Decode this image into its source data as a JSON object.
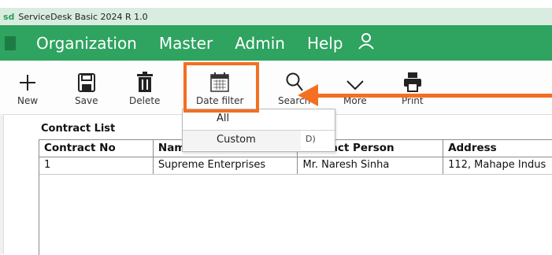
{
  "title": {
    "logo": "sd",
    "text": "ServiceDesk Basic 2024 R 1.0"
  },
  "menu": {
    "items": [
      "Organization",
      "Master",
      "Admin",
      "Help"
    ],
    "user_icon": "user-icon"
  },
  "toolbar": {
    "new_label": "New",
    "save_label": "Save",
    "delete_label": "Delete",
    "date_filter_label": "Date filter",
    "search_label": "Search",
    "more_label": "More",
    "print_label": "Print",
    "icons": [
      "plus-icon",
      "save-icon",
      "trash-icon",
      "calendar-icon",
      "search-icon",
      "chevron-down-icon",
      "printer-icon"
    ]
  },
  "dropdown": {
    "options": [
      "All",
      "Custom"
    ],
    "partial_text": "D)"
  },
  "contract_list": {
    "title": "Contract List",
    "columns": [
      "Contract No",
      "Nam",
      "Contact Person",
      "Address"
    ],
    "rows": [
      [
        "1",
        "Supreme Enterprises",
        "Mr. Naresh Sinha",
        "112, Mahape Indus"
      ]
    ]
  },
  "annotation": {
    "color": "#f36f21"
  },
  "colors": {
    "menu_bg": "#2fa360",
    "title_bg": "#d8ecdf"
  }
}
